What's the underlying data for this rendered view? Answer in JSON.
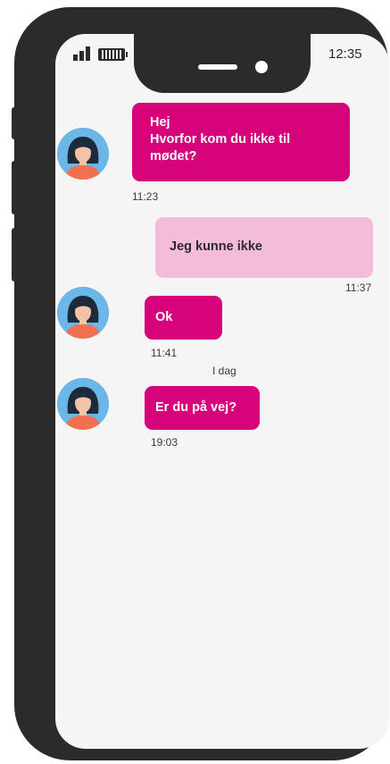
{
  "status_bar": {
    "time": "12:35",
    "signal_icon": "signal-icon",
    "battery_icon": "battery-icon"
  },
  "chat": {
    "messages": [
      {
        "direction": "incoming",
        "lines": [
          "Hej",
          "Hvorfor kom du ikke til",
          "mødet?"
        ],
        "time": "11:23"
      },
      {
        "direction": "outgoing",
        "text": "Jeg kunne ikke",
        "time": "11:37"
      },
      {
        "direction": "incoming",
        "text": "Ok",
        "time": "11:41"
      },
      {
        "direction": "incoming",
        "text": "Er du på vej?",
        "time": "19:03"
      }
    ],
    "day_divider": "I dag"
  },
  "colors": {
    "incoming_bubble": "#d6037a",
    "outgoing_bubble": "#f3bcd9",
    "phone_frame": "#2b2b2b",
    "screen": "#f5f5f5"
  }
}
